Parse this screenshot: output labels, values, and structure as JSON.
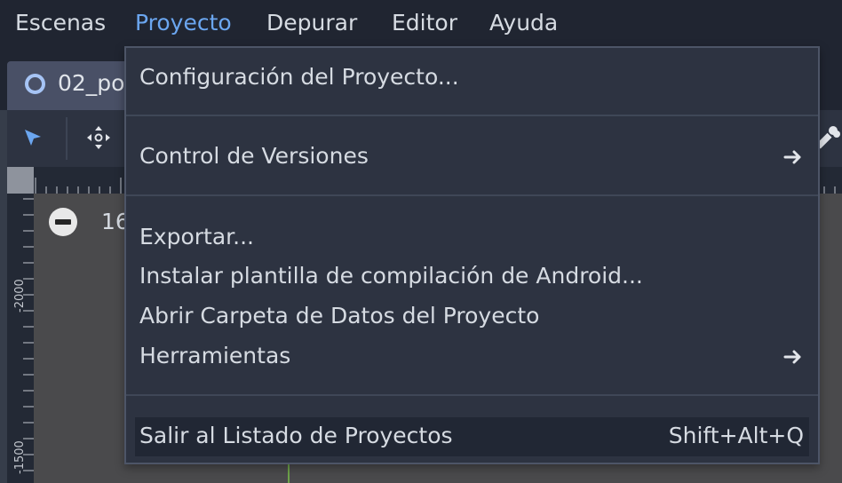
{
  "menubar": {
    "items": [
      {
        "label": "Escenas"
      },
      {
        "label": "Proyecto",
        "active": true
      },
      {
        "label": "Depurar"
      },
      {
        "label": "Editor"
      },
      {
        "label": "Ayuda"
      }
    ]
  },
  "scene_tab": {
    "label": "02_po",
    "icon": "scene-ring-icon"
  },
  "toolbar": {
    "icons": [
      "select-arrow-icon",
      "move-icon",
      "bone-icon"
    ]
  },
  "viewport": {
    "zoom_value": "16",
    "ruler_labels": [
      "-2000",
      "-1500"
    ]
  },
  "project_menu": {
    "items": [
      {
        "label": "Configuración del Proyecto..."
      },
      {
        "label": "Control de Versiones",
        "submenu": true
      },
      {
        "label": "Exportar..."
      },
      {
        "label": "Instalar plantilla de compilación de Android..."
      },
      {
        "label": "Abrir Carpeta de Datos del Proyecto"
      },
      {
        "label": "Herramientas",
        "submenu": true
      },
      {
        "label": "Salir al Listado de Proyectos",
        "shortcut": "Shift+Alt+Q",
        "hovered": true
      }
    ]
  },
  "colors": {
    "accent": "#6ba6f0",
    "menu_bg": "#2d3341",
    "menubar_bg": "#202531",
    "viewport_bg": "#4a4a4c"
  }
}
